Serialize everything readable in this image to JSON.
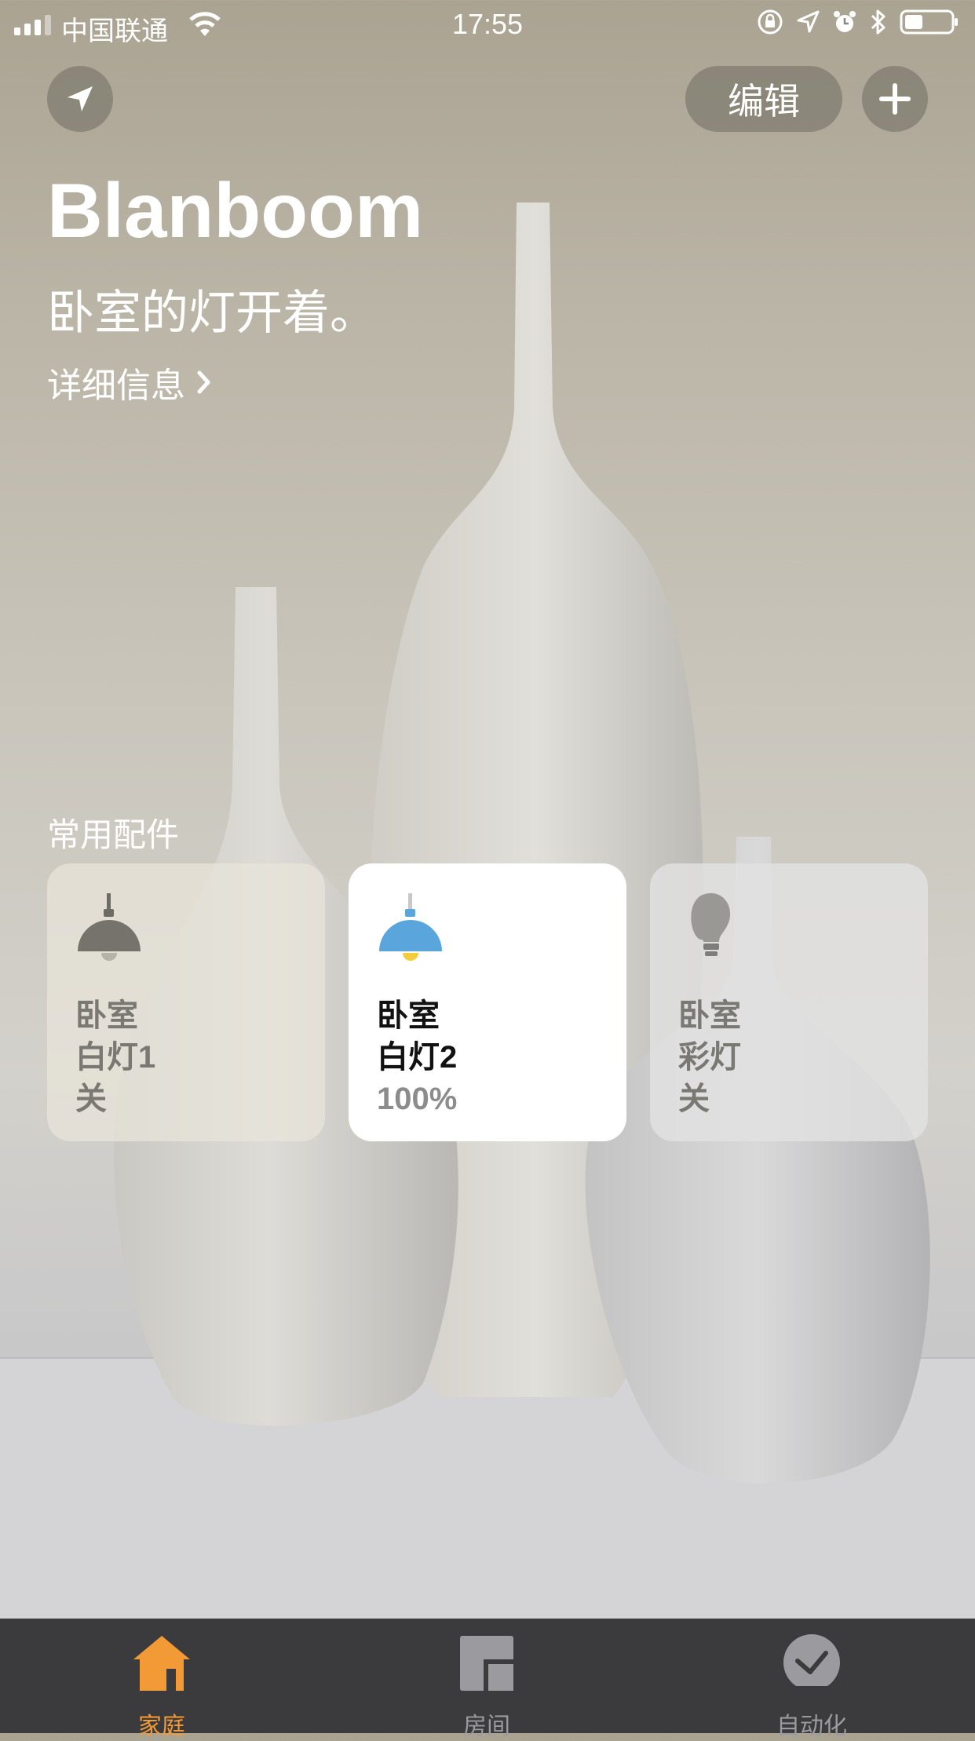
{
  "status_bar": {
    "carrier": "中国联通",
    "time": "17:55"
  },
  "header": {
    "edit_label": "编辑"
  },
  "home": {
    "title": "Blanboom",
    "status": "卧室的灯开着。",
    "details_link": "详细信息"
  },
  "favorites": {
    "title": "常用配件",
    "tiles": [
      {
        "room": "卧室",
        "name": "白灯1",
        "state": "关",
        "icon": "pendant-lamp-off-icon"
      },
      {
        "room": "卧室",
        "name": "白灯2",
        "state": "100%",
        "icon": "pendant-lamp-on-icon"
      },
      {
        "room": "卧室",
        "name": "彩灯",
        "state": "关",
        "icon": "light-bulb-icon"
      }
    ]
  },
  "tab_bar": {
    "tabs": [
      {
        "label": "家庭",
        "icon": "house-icon",
        "selected": true
      },
      {
        "label": "房间",
        "icon": "rooms-icon",
        "selected": false
      },
      {
        "label": "自动化",
        "icon": "automation-icon",
        "selected": false
      }
    ]
  },
  "colors": {
    "accent": "#f29a35",
    "lamp_on": "#5aa6dc",
    "bulb_glow": "#f5cd3c",
    "tab_bar_bg": "#3b3b3d"
  }
}
